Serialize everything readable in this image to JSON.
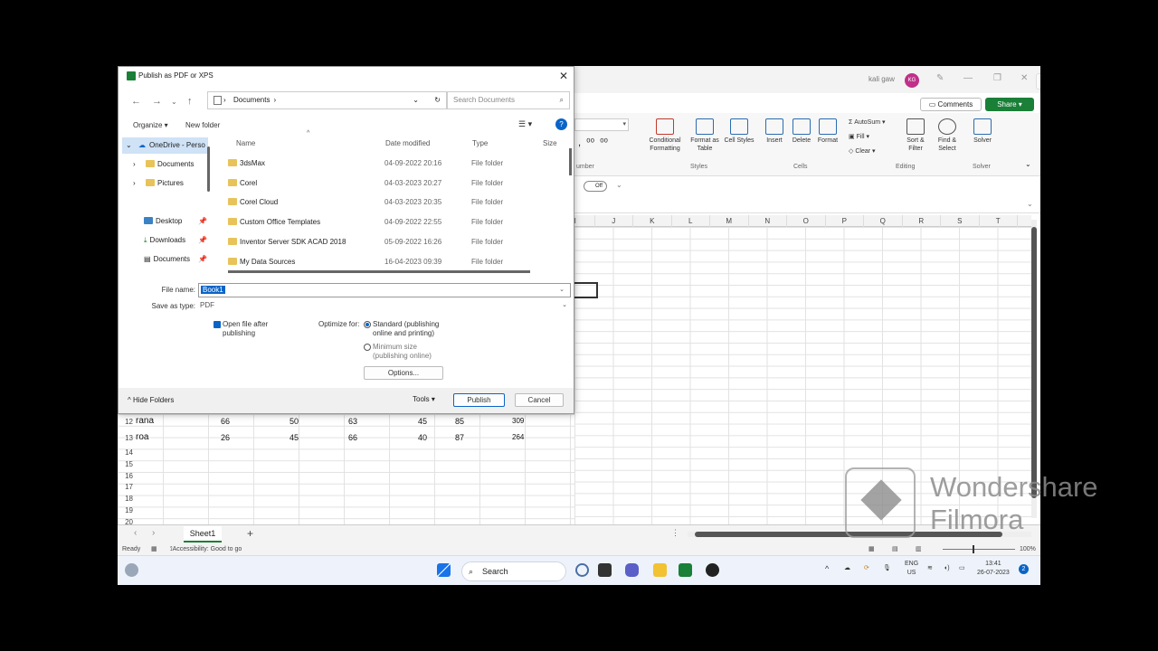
{
  "dialog": {
    "title": "Publish as PDF or XPS",
    "address": "Documents",
    "search_placeholder": "Search Documents",
    "organize": "Organize ▾",
    "new_folder": "New folder",
    "tree": [
      {
        "label": "OneDrive - Perso"
      },
      {
        "label": "Documents"
      },
      {
        "label": "Pictures"
      },
      {
        "label": "Desktop"
      },
      {
        "label": "Downloads"
      },
      {
        "label": "Documents"
      }
    ],
    "columns": {
      "name": "Name",
      "date": "Date modified",
      "type": "Type",
      "size": "Size"
    },
    "files": [
      {
        "name": "3dsMax",
        "date": "04-09-2022 20:16",
        "type": "File folder"
      },
      {
        "name": "Corel",
        "date": "04-03-2023 20:27",
        "type": "File folder"
      },
      {
        "name": "Corel Cloud",
        "date": "04-03-2023 20:35",
        "type": "File folder"
      },
      {
        "name": "Custom Office Templates",
        "date": "04-09-2022 22:55",
        "type": "File folder"
      },
      {
        "name": "Inventor Server SDK ACAD 2018",
        "date": "05-09-2022 16:26",
        "type": "File folder"
      },
      {
        "name": "My Data Sources",
        "date": "16-04-2023 09:39",
        "type": "File folder"
      }
    ],
    "file_name_label": "File name:",
    "file_name_value": "Book1",
    "save_type_label": "Save as type:",
    "save_type_value": "PDF",
    "open_after": "Open file after publishing",
    "optimize_label": "Optimize for:",
    "opt_standard": "Standard (publishing online and printing)",
    "opt_minimum": "Minimum size (publishing online)",
    "options_btn": "Options...",
    "hide_folders": "Hide Folders",
    "tools": "Tools",
    "publish": "Publish",
    "cancel": "Cancel"
  },
  "excel": {
    "user": "kali gaw",
    "avatar": "KG",
    "comments": "Comments",
    "share": "Share",
    "ribbon": {
      "cond_format": "Conditional Formatting",
      "format_table": "Format as Table",
      "cell_styles": "Cell Styles",
      "insert": "Insert",
      "delete": "Delete",
      "format": "Format",
      "autosum": "AutoSum",
      "fill": "Fill",
      "clear": "Clear",
      "sort_filter": "Sort & Filter",
      "find_select": "Find & Select",
      "solver": "Solver",
      "g_number": "umber",
      "g_styles": "Styles",
      "g_cells": "Cells",
      "g_editing": "Editing",
      "g_solver": "Solver",
      "toggle": "Off"
    },
    "columns": [
      "I",
      "J",
      "K",
      "L",
      "M",
      "N",
      "O",
      "P",
      "Q",
      "R",
      "S",
      "T"
    ],
    "rows": [
      {
        "num": "12",
        "name": "rana",
        "v": [
          "66",
          "50",
          "63",
          "45",
          "85",
          "309"
        ]
      },
      {
        "num": "13",
        "name": "roa",
        "v": [
          "26",
          "45",
          "66",
          "40",
          "87",
          "264"
        ]
      }
    ],
    "empty_rows": [
      "14",
      "15",
      "16",
      "17",
      "18",
      "19",
      "20"
    ],
    "sheet_tab": "Sheet1",
    "status_ready": "Ready",
    "status_access": "Accessibility: Good to go",
    "zoom": "100%"
  },
  "taskbar": {
    "search": "Search",
    "lang": "ENG",
    "region": "US",
    "time": "13:41",
    "date": "26-07-2023",
    "badge": "2"
  },
  "watermark": {
    "line1": "Wondershare",
    "line2": "Filmora"
  }
}
